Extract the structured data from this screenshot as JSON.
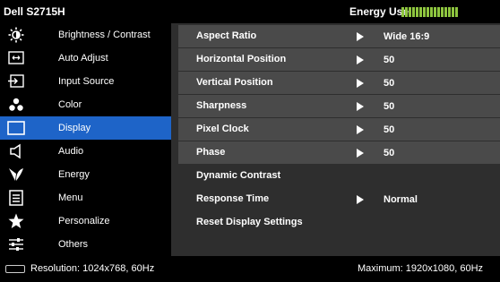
{
  "header": {
    "model": "Dell S2715H",
    "energy_label": "Energy Use",
    "energy_level": 0.67,
    "energy_color": "#8ec63f"
  },
  "sidebar": {
    "active_color": "#1e64c8",
    "items": [
      {
        "label": "Brightness / Contrast",
        "icon": "brightness-icon"
      },
      {
        "label": "Auto Adjust",
        "icon": "auto-adjust-icon"
      },
      {
        "label": "Input Source",
        "icon": "input-source-icon"
      },
      {
        "label": "Color",
        "icon": "color-icon"
      },
      {
        "label": "Display",
        "icon": "display-icon",
        "active": true
      },
      {
        "label": "Audio",
        "icon": "audio-icon"
      },
      {
        "label": "Energy",
        "icon": "energy-icon"
      },
      {
        "label": "Menu",
        "icon": "menu-icon"
      },
      {
        "label": "Personalize",
        "icon": "personalize-icon"
      },
      {
        "label": "Others",
        "icon": "others-icon"
      }
    ]
  },
  "display_settings": {
    "rows": [
      {
        "label": "Aspect Ratio",
        "value": "Wide 16:9",
        "arrow": true
      },
      {
        "label": "Horizontal Position",
        "value": "50",
        "arrow": true
      },
      {
        "label": "Vertical Position",
        "value": "50",
        "arrow": true
      },
      {
        "label": "Sharpness",
        "value": "50",
        "arrow": true
      },
      {
        "label": "Pixel Clock",
        "value": "50",
        "arrow": true
      },
      {
        "label": "Phase",
        "value": "50",
        "arrow": true
      },
      {
        "label": "Dynamic Contrast",
        "value": "",
        "arrow": false
      },
      {
        "label": "Response Time",
        "value": "Normal",
        "arrow": true
      },
      {
        "label": "Reset Display Settings",
        "value": "",
        "arrow": false
      }
    ]
  },
  "footer": {
    "resolution": "Resolution: 1024x768, 60Hz",
    "maximum": "Maximum: 1920x1080, 60Hz",
    "icon": "input-cable-icon"
  }
}
